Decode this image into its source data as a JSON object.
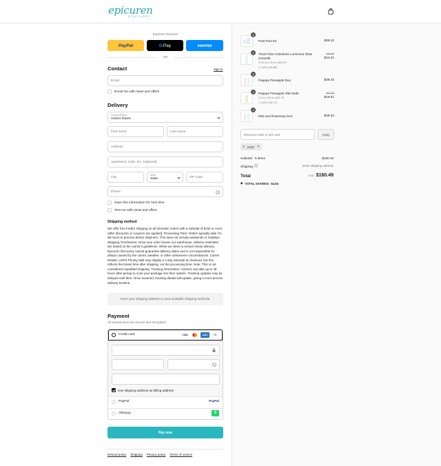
{
  "brand": {
    "name": "epicuren",
    "sub": "DISCOVERY",
    "accent": "#2aa6a8"
  },
  "header": {
    "bag_icon": "shopping-bag-icon"
  },
  "express": {
    "title": "Express checkout",
    "paypal": "PayPal",
    "gpay_g": "G",
    "gpay": "Pay",
    "venmo": "venmo",
    "or": "OR"
  },
  "contact": {
    "heading": "Contact",
    "sign_in": "Sign in",
    "email_placeholder": "Email",
    "email_news": "Email me with news and offers"
  },
  "delivery": {
    "heading": "Delivery",
    "country_label": "Country/Region",
    "country_value": "United States",
    "first_name": "First name",
    "last_name": "Last name",
    "address": "Address",
    "apartment": "Apartment, suite, etc. (optional)",
    "city": "City",
    "state_label": "State",
    "state_value": "State",
    "zip": "ZIP code",
    "phone": "Phone",
    "save_info": "Save this information for next time",
    "text_news": "Text me with news and offers"
  },
  "shipping": {
    "heading": "Shipping method",
    "policy": "We offer free FedEx shipping on all domestic orders with a subtotal of $150 or more (after discounts or coupons are applied). Processing Time: Orders typically take 72–96 hours to process before shipment. This does not include weekends or holidays. Shipping Timeframes: Once your order leaves our warehouse, delivery estimates are based on the carrier's guidelines. While we strive to ensure timely delivery, Epicuren Discovery cannot guarantee delivery dates and is not responsible for delays caused by the carrier, weather, or other unforeseen circumstances. Carrier Details: USPS Priority Mail may display a 3 day estimate at checkout, but this reflects the transit time after shipping, not the processing time. Note: This is not considered expedited shipping. Tracking Information: Carriers can take up to 48 hours after pickup to scan your package into their system. Tracking updates may be delayed until then. Once scanned, tracking details will update, giving a more precise delivery timeline.",
    "placeholder": "Enter your shipping address to view available shipping methods."
  },
  "payment": {
    "heading": "Payment",
    "subtitle": "All transactions are secure and encrypted.",
    "credit_card": "Credit card",
    "visa": "VISA",
    "amex": "AMEX",
    "more_cards": "+3",
    "billing_same": "Use shipping address as billing address",
    "paypal": "PayPal",
    "paypal_logo": "PayPal",
    "afterpay": "Afterpay",
    "afterpay_logo": "$",
    "pay_now": "Pay now"
  },
  "footer": {
    "links": [
      "Refund policy",
      "Shipping",
      "Privacy policy",
      "Terms of service"
    ]
  },
  "cart": {
    "items": [
      {
        "qty": "1",
        "name": "Post Peel Kit",
        "variant": "",
        "discount": "",
        "original": "",
        "price": "$38.22"
      },
      {
        "qty": "1",
        "name": "Travel Size Colostrum Luminous Glow Creamfit",
        "variant": "0.5 fl oz | 15 ml | $26.99",
        "discount": "JU10 (-$2.85)",
        "original": "$26.85",
        "price": "$24.02"
      },
      {
        "qty": "1",
        "name": "Papaya Pineapple Duo",
        "variant": "",
        "discount": "",
        "original": "",
        "price": "$39.32"
      },
      {
        "qty": "1",
        "name": "Papaya Pineapple After Bath",
        "variant": "2 fl oz | 60 ml | $21.78",
        "discount": "JU10 (-$2.17)",
        "original": "$21.78",
        "price": "$19.61"
      },
      {
        "qty": "1",
        "name": "Mint and Rosemary Duo",
        "variant": "",
        "discount": "",
        "original": "",
        "price": "$39.32"
      }
    ],
    "discount_placeholder": "Discount code or gift card",
    "apply": "Apply",
    "code_tag": "JU10",
    "subtotal_label": "Subtotal · 5 items",
    "subtotal_value": "$160.49",
    "shipping_label": "Shipping",
    "shipping_value": "Enter shipping address",
    "total_label": "Total",
    "currency": "USD",
    "total_value": "$160.49",
    "savings_label": "TOTAL SAVINGS",
    "savings_value": "$4.63"
  }
}
